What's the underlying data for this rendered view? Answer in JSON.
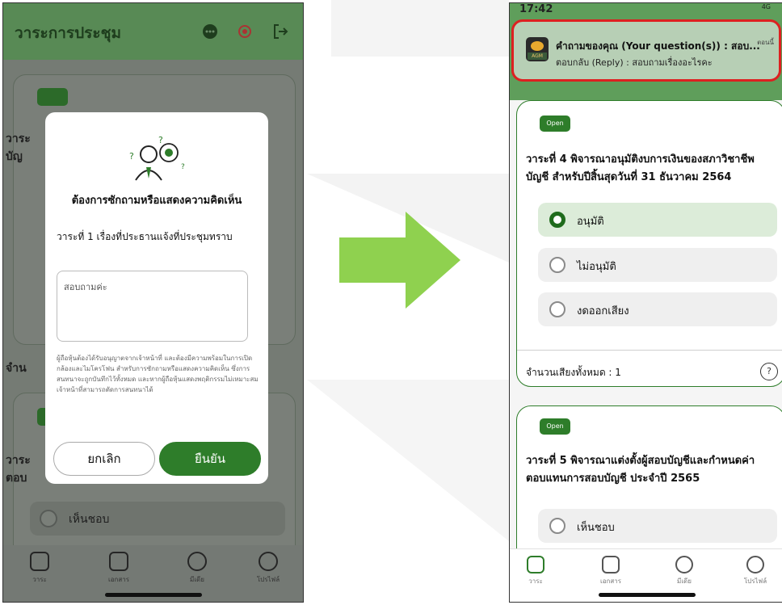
{
  "left_phone": {
    "header_title": "วาระการประชุม",
    "dialog": {
      "title": "ต้องการซักถามหรือแสดงความคิดเห็น",
      "agenda_line": "วาระที่ 1 เรื่องที่ประธานแจ้งที่ประชุมทราบ",
      "input_value": "สอบถามค่ะ",
      "notice": "ผู้ถือหุ้นต้องได้รับอนุญาตจากเจ้าหน้าที่ และต้องมีความพร้อมในการเปิดกล้องและไมโครโฟน สำหรับการซักถามหรือแสดงความคิดเห็น ซึ่งการสนทนาจะถูกบันทึกไว้ทั้งหมด และหากผู้ถือหุ้นแสดงพฤติกรรมไม่เหมาะสม เจ้าหน้าที่สามารถตัดการสนทนาได้",
      "cancel_label": "ยกเลิก",
      "confirm_label": "ยืนยัน"
    },
    "bg_card1": {
      "tag": "Open",
      "title_line1": "วาระ",
      "title_line2": "บัญ"
    },
    "bg_total_label": "จำน",
    "bg_card2": {
      "title_line1": "วาระ",
      "title_line2": "ตอบ",
      "option": "เห็นชอบ"
    },
    "tabs": [
      "วาระ",
      "เอกสาร",
      "มีเดีย",
      "โปรไฟล์"
    ]
  },
  "right_phone": {
    "status_time": "17:42",
    "status_signal": "4G",
    "notification": {
      "line1": "คำถามของคุณ (Your question(s)) : สอบ...",
      "line2": "ตอบกลับ (Reply) : สอบถามเรื่องอะไรคะ",
      "time": "ตอนนี้",
      "app_badge": "AGM"
    },
    "card1": {
      "tag": "Open",
      "title": "วาระที่ 4 พิจารณาอนุมัติงบการเงินของสภาวิชาชีพบัญชี สำหรับปีสิ้นสุดวันที่ 31 ธันวาคม 2564",
      "options": [
        "อนุมัติ",
        "ไม่อนุมัติ",
        "งดออกเสียง"
      ],
      "selected_option": "อนุมัติ",
      "total_votes": "จำนวนเสียงทั้งหมด : 1"
    },
    "card2": {
      "tag": "Open",
      "title": "วาระที่ 5 พิจารณาแต่งตั้งผู้สอบบัญชีและกำหนดค่าตอบแทนการสอบบัญชี ประจำปี 2565",
      "options": [
        "เห็นชอบ"
      ]
    },
    "tabs": [
      "วาระ",
      "เอกสาร",
      "มีเดีย",
      "โปรไฟล์"
    ]
  },
  "colors": {
    "brand_green": "#2e7d2a",
    "highlight_red": "#dd2020",
    "arrow_green": "#8fd14f"
  }
}
